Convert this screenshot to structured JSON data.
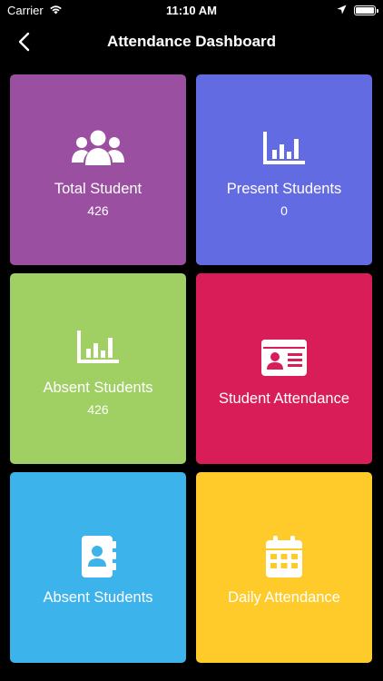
{
  "status_bar": {
    "carrier": "Carrier",
    "time": "11:10 AM",
    "icons": [
      "wifi-icon",
      "location-icon",
      "battery-icon"
    ]
  },
  "header": {
    "title": "Attendance Dashboard",
    "back_icon": "chevron-left-icon"
  },
  "tiles": [
    {
      "label": "Total Student",
      "value": "426",
      "icon": "users-icon",
      "color": "#9B4FA0"
    },
    {
      "label": "Present Students",
      "value": "0",
      "icon": "bar-chart-icon",
      "color": "#626BE2"
    },
    {
      "label": "Absent Students",
      "value": "426",
      "icon": "bar-chart-icon",
      "color": "#A0CF63"
    },
    {
      "label": "Student Attendance",
      "value": "",
      "icon": "id-card-icon",
      "color": "#D81D58"
    },
    {
      "label": "Absent Students",
      "value": "",
      "icon": "contact-book-icon",
      "color": "#3DB3EC"
    },
    {
      "label": "Daily Attendance",
      "value": "",
      "icon": "calendar-icon",
      "color": "#FFCB2B"
    }
  ]
}
